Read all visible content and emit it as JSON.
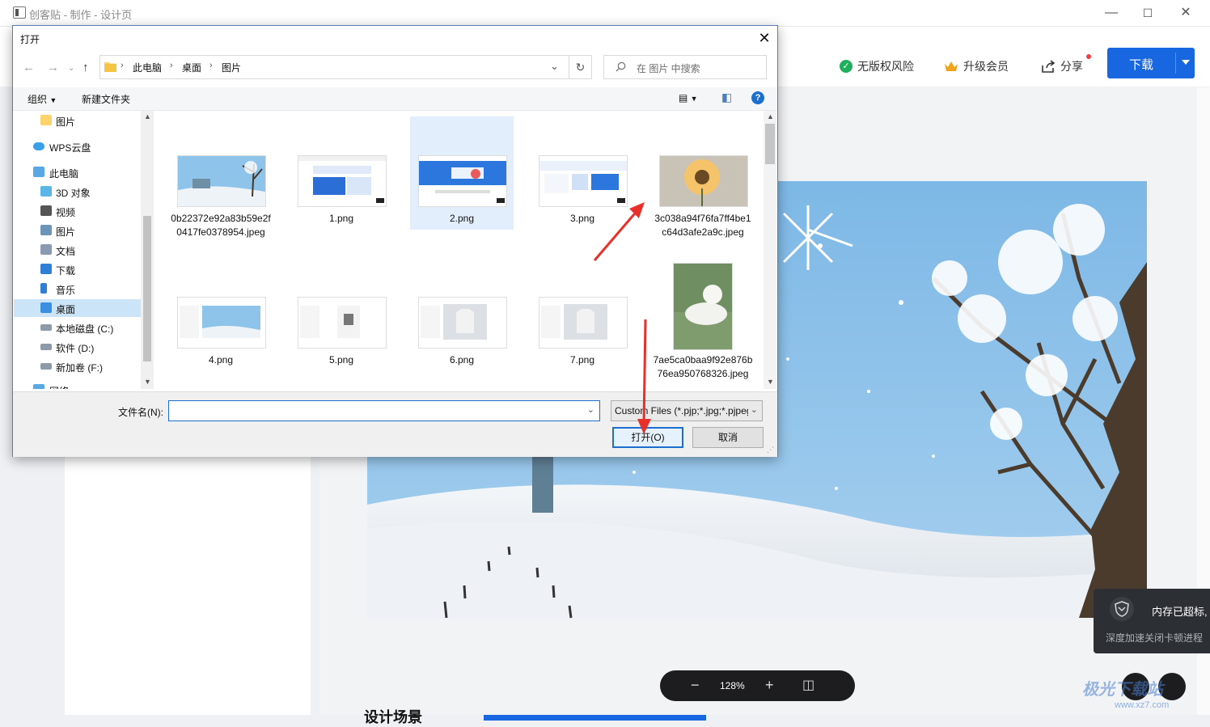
{
  "app": {
    "title": "创客贴 - 制作 - 设计页",
    "header": {
      "copyright_label": "无版权风险",
      "upgrade_label": "升级会员",
      "share_label": "分享",
      "download_label": "下载"
    },
    "zoom": {
      "value": "128%"
    },
    "toast": {
      "line1": "内存已超标,",
      "line2": "深度加速关闭卡顿进程"
    },
    "bottom_text": "设计场景"
  },
  "dialog": {
    "title": "打开",
    "address": {
      "segments": [
        "此电脑",
        "桌面",
        "图片"
      ]
    },
    "search_placeholder": "在 图片 中搜索",
    "toolbar": {
      "organize": "组织",
      "new_folder": "新建文件夹"
    },
    "nav_items": [
      {
        "label": "图片",
        "icon": "folder-icon"
      },
      {
        "label": "WPS云盘",
        "icon": "cloud-icon"
      },
      {
        "label": "此电脑",
        "icon": "computer-icon"
      },
      {
        "label": "3D 对象",
        "icon": "cube-icon"
      },
      {
        "label": "视频",
        "icon": "video-icon"
      },
      {
        "label": "图片",
        "icon": "picture-icon"
      },
      {
        "label": "文档",
        "icon": "document-icon"
      },
      {
        "label": "下载",
        "icon": "download-icon"
      },
      {
        "label": "音乐",
        "icon": "music-icon"
      },
      {
        "label": "桌面",
        "icon": "desktop-icon",
        "selected": true
      },
      {
        "label": "本地磁盘 (C:)",
        "icon": "drive-icon"
      },
      {
        "label": "软件 (D:)",
        "icon": "drive-icon"
      },
      {
        "label": "新加卷 (F:)",
        "icon": "drive-icon"
      },
      {
        "label": "网络",
        "icon": "network-icon"
      }
    ],
    "files": [
      {
        "name": "0b22372e92a83b59e2f0417fe0378954.jpeg",
        "kind": "snow"
      },
      {
        "name": "1.png",
        "kind": "screenshot"
      },
      {
        "name": "2.png",
        "kind": "screenshot-blue",
        "selected": true
      },
      {
        "name": "3.png",
        "kind": "screenshot"
      },
      {
        "name": "3c038a94f76fa7ff4be1c64d3afe2a9c.jpeg",
        "kind": "flower"
      },
      {
        "name": "4.png",
        "kind": "snow-ui"
      },
      {
        "name": "5.png",
        "kind": "ui"
      },
      {
        "name": "6.png",
        "kind": "tshirt"
      },
      {
        "name": "7.png",
        "kind": "tshirt"
      },
      {
        "name": "7ae5ca0baa9f92e876b76ea950768326.jpeg",
        "kind": "cat"
      }
    ],
    "filename_label": "文件名(N):",
    "filename_value": "",
    "filetype": "Custom Files (*.pjp;*.jpg;*.pjpeg;*.jpeg)",
    "open_label": "打开(O)",
    "cancel_label": "取消"
  },
  "watermark": {
    "main": "极光下载站",
    "sub": "www.xz7.com"
  },
  "colors": {
    "accent": "#1967e0",
    "annotation_arrow": "#e8302a"
  }
}
